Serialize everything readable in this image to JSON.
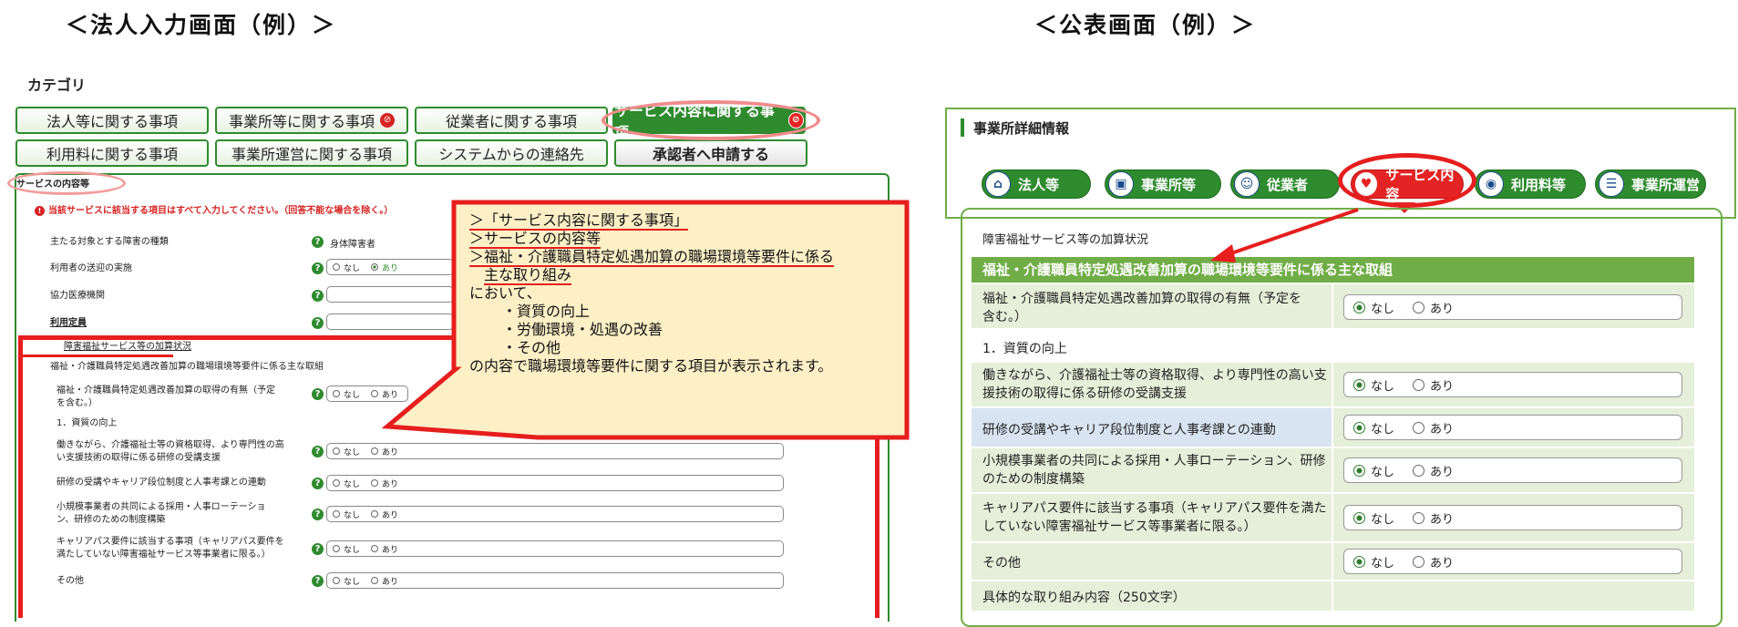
{
  "headings": {
    "left": "＜法人入力画面（例）＞",
    "right": "＜公表画面（例）＞"
  },
  "left": {
    "category_label": "カテゴリ",
    "tabs_row1": [
      "法人等に関する事項",
      "事業所等に関する事項",
      "従業者に関する事項",
      "サービス内容に関する事項"
    ],
    "tabs_row2": [
      "利用料に関する事項",
      "事業所運営に関する事項",
      "システムからの連絡先",
      "承認者へ申請する"
    ],
    "section_title": "サービスの内容等",
    "notice": "当該サービスに該当する項目はすべて入力してください。（回答不能な場合を除く。）",
    "fields": [
      {
        "label": "主たる対象とする障害の種類",
        "value": "身体障害者"
      },
      {
        "label": "利用者の送迎の実施",
        "opt1": "なし",
        "opt2": "あり"
      },
      {
        "label": "協力医療機関"
      },
      {
        "label": "利用定員"
      }
    ],
    "subsection": "障害福祉サービス等の加算状況",
    "subsection2": "福祉・介護職員特定処遇改善加算の職場環境等要件に係る主な取組",
    "items": [
      {
        "label": "福祉・介護職員特定処遇改善加算の取得の有無（予定を含む。）",
        "opt1": "なし",
        "opt2": "あり"
      },
      {
        "label": "1．資質の向上"
      },
      {
        "label": "働きながら、介護福祉士等の資格取得、より専門性の高い支援技術の取得に係る研修の受講支援",
        "opt1": "なし",
        "opt2": "あり"
      },
      {
        "label": "研修の受講やキャリア段位制度と人事考課との連動",
        "opt1": "なし",
        "opt2": "あり"
      },
      {
        "label": "小規模事業者の共同による採用・人事ローテーション、研修のための制度構築",
        "opt1": "なし",
        "opt2": "あり"
      },
      {
        "label": "キャリアパス要件に該当する事項（キャリアパス要件を満たしていない障害福祉サービス等事業者に限る。）",
        "opt1": "なし",
        "opt2": "あり"
      },
      {
        "label": "その他",
        "opt1": "なし",
        "opt2": "あり"
      }
    ]
  },
  "callout": {
    "l1": "＞「サービス内容に関する事項」",
    "l2": "＞サービスの内容等",
    "l3": "＞福祉・介護職員特定処遇加算の職場環境等要件に係る",
    "l4": "主な取り組み",
    "l5": "において、",
    "l6": "・資質の向上",
    "l7": "・労働環境・処遇の改善",
    "l8": "・その他",
    "l9": "の内容で職場環境等要件に関する項目が表示されます。"
  },
  "right": {
    "panel_title": "事業所詳細情報",
    "tabs": [
      {
        "label": "法人等",
        "icon": "home-icon"
      },
      {
        "label": "事業所等",
        "icon": "building-icon"
      },
      {
        "label": "従業者",
        "icon": "people-icon"
      },
      {
        "label": "サービス内容",
        "icon": "care-icon"
      },
      {
        "label": "利用料等",
        "icon": "pin-icon"
      },
      {
        "label": "事業所運営",
        "icon": "list-icon"
      }
    ],
    "section_label": "障害福祉サービス等の加算状況",
    "header_bar": "福祉・介護職員特定処遇改善加算の職場環境等要件に係る主な取組",
    "rows": [
      {
        "label": "福祉・介護職員特定処遇改善加算の取得の有無（予定を含む。）",
        "opt1": "なし",
        "opt2": "あり"
      },
      {
        "label": "1．資質の向上"
      },
      {
        "label": "働きながら、介護福祉士等の資格取得、より専門性の高い支援技術の取得に係る研修の受講支援",
        "opt1": "なし",
        "opt2": "あり"
      },
      {
        "label": "研修の受講やキャリア段位制度と人事考課との連動",
        "opt1": "なし",
        "opt2": "あり"
      },
      {
        "label": "小規模事業者の共同による採用・人事ローテーション、研修のための制度構築",
        "opt1": "なし",
        "opt2": "あり"
      },
      {
        "label": "キャリアパス要件に該当する事項（キャリアパス要件を満たしていない障害福祉サービス等事業者に限る。）",
        "opt1": "なし",
        "opt2": "あり"
      },
      {
        "label": "その他",
        "opt1": "なし",
        "opt2": "あり"
      },
      {
        "label": "具体的な取り組み内容（250文字）"
      }
    ]
  },
  "colors": {
    "accent_green": "#2e8b2e",
    "highlight_red": "#e61e1e",
    "callout_bg": "#fdf0c6",
    "public_green": "#70ad47"
  }
}
